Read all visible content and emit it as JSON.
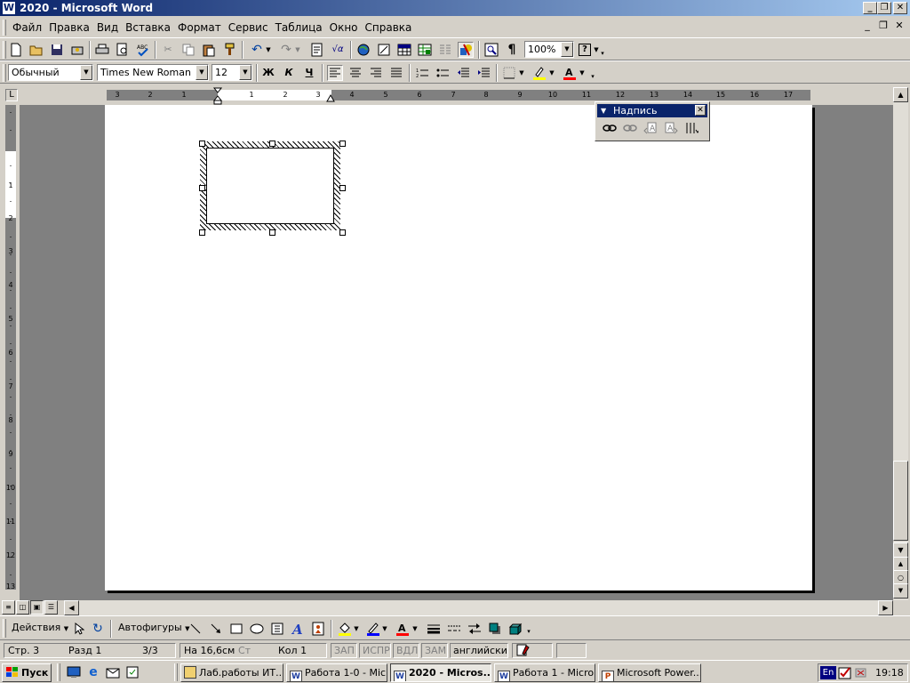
{
  "window": {
    "title": "2020 - Microsoft Word",
    "app_icon": "W"
  },
  "window_buttons": {
    "minimize": "_",
    "maximize": "❐",
    "close": "✕"
  },
  "menu": {
    "items": [
      "Файл",
      "Правка",
      "Вид",
      "Вставка",
      "Формат",
      "Сервис",
      "Таблица",
      "Окно",
      "Справка"
    ],
    "doc_buttons": {
      "minimize": "_",
      "restore": "❐",
      "close": "✕"
    }
  },
  "standard_toolbar": {
    "zoom": "100%",
    "help": "?"
  },
  "formatting_toolbar": {
    "style": "Обычный",
    "font": "Times New Roman",
    "size": "12",
    "bold": "Ж",
    "italic": "К",
    "underline": "Ч"
  },
  "ruler": {
    "h_labels": [
      "3",
      "2",
      "1",
      "1",
      "2",
      "3",
      "4",
      "5",
      "6",
      "7",
      "8",
      "9",
      "10",
      "11",
      "12",
      "13",
      "14",
      "15",
      "16",
      "17"
    ],
    "tab_selector": "L"
  },
  "float_toolbar": {
    "title": "Надпись"
  },
  "drawing_toolbar": {
    "actions": "Действия",
    "autoshapes": "Автофигуры"
  },
  "statusbar": {
    "page": "Стр. 3",
    "section": "Разд 1",
    "pages": "3/3",
    "position": "На 16,6см",
    "line": "Ст",
    "column": "Кол 1",
    "rec": "ЗАП",
    "track": "ИСПР",
    "ext": "ВДЛ",
    "ovr": "ЗАМ",
    "language": "английский"
  },
  "taskbar": {
    "start": "Пуск",
    "tasks": [
      {
        "label": "Лаб.работы ИТ...",
        "icon": "folder-icon"
      },
      {
        "label": "Работа 1-0 - Mic...",
        "icon": "word-icon"
      },
      {
        "label": "2020 - Micros...",
        "icon": "word-icon",
        "active": true
      },
      {
        "label": "Работа 1 - Micro...",
        "icon": "word-icon"
      },
      {
        "label": "Microsoft Power...",
        "icon": "powerpoint-icon"
      }
    ],
    "lang": "En",
    "clock": "19:18"
  }
}
